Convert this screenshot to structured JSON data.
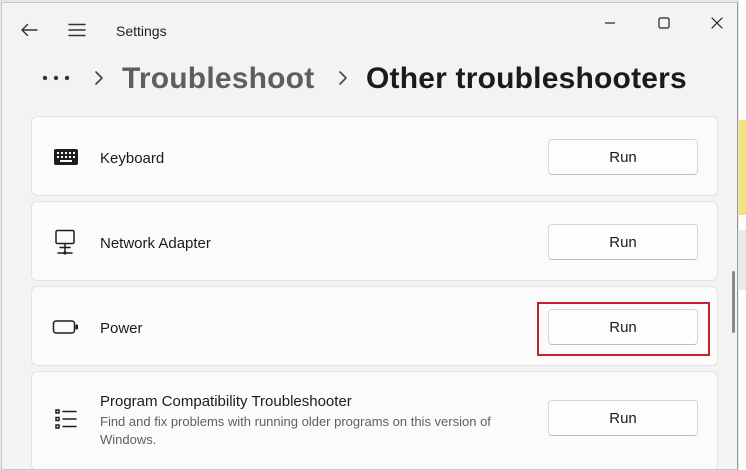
{
  "window": {
    "app_title": "Settings",
    "controls": {
      "minimize_icon": "minimize-icon",
      "maximize_icon": "maximize-icon",
      "close_icon": "close-icon"
    }
  },
  "navigation": {
    "back_icon": "back-arrow-icon",
    "menu_icon": "hamburger-menu-icon"
  },
  "breadcrumb": {
    "more_label": "•••",
    "parent": "Troubleshoot",
    "current": "Other troubleshooters"
  },
  "troubleshooters": [
    {
      "icon": "keyboard-icon",
      "title": "Keyboard",
      "description": "",
      "button_label": "Run"
    },
    {
      "icon": "network-adapter-icon",
      "title": "Network Adapter",
      "description": "",
      "button_label": "Run"
    },
    {
      "icon": "battery-icon",
      "title": "Power",
      "description": "",
      "button_label": "Run",
      "highlighted": true
    },
    {
      "icon": "list-icon",
      "title": "Program Compatibility Troubleshooter",
      "description": "Find and fix problems with running older programs on this version of Windows.",
      "button_label": "Run"
    }
  ],
  "colors": {
    "window_bg": "#f3f3f3",
    "card_bg": "#fbfbfb",
    "highlight": "#c1242f",
    "text_primary": "#1b1b1b",
    "text_secondary": "#5f5f5f"
  }
}
